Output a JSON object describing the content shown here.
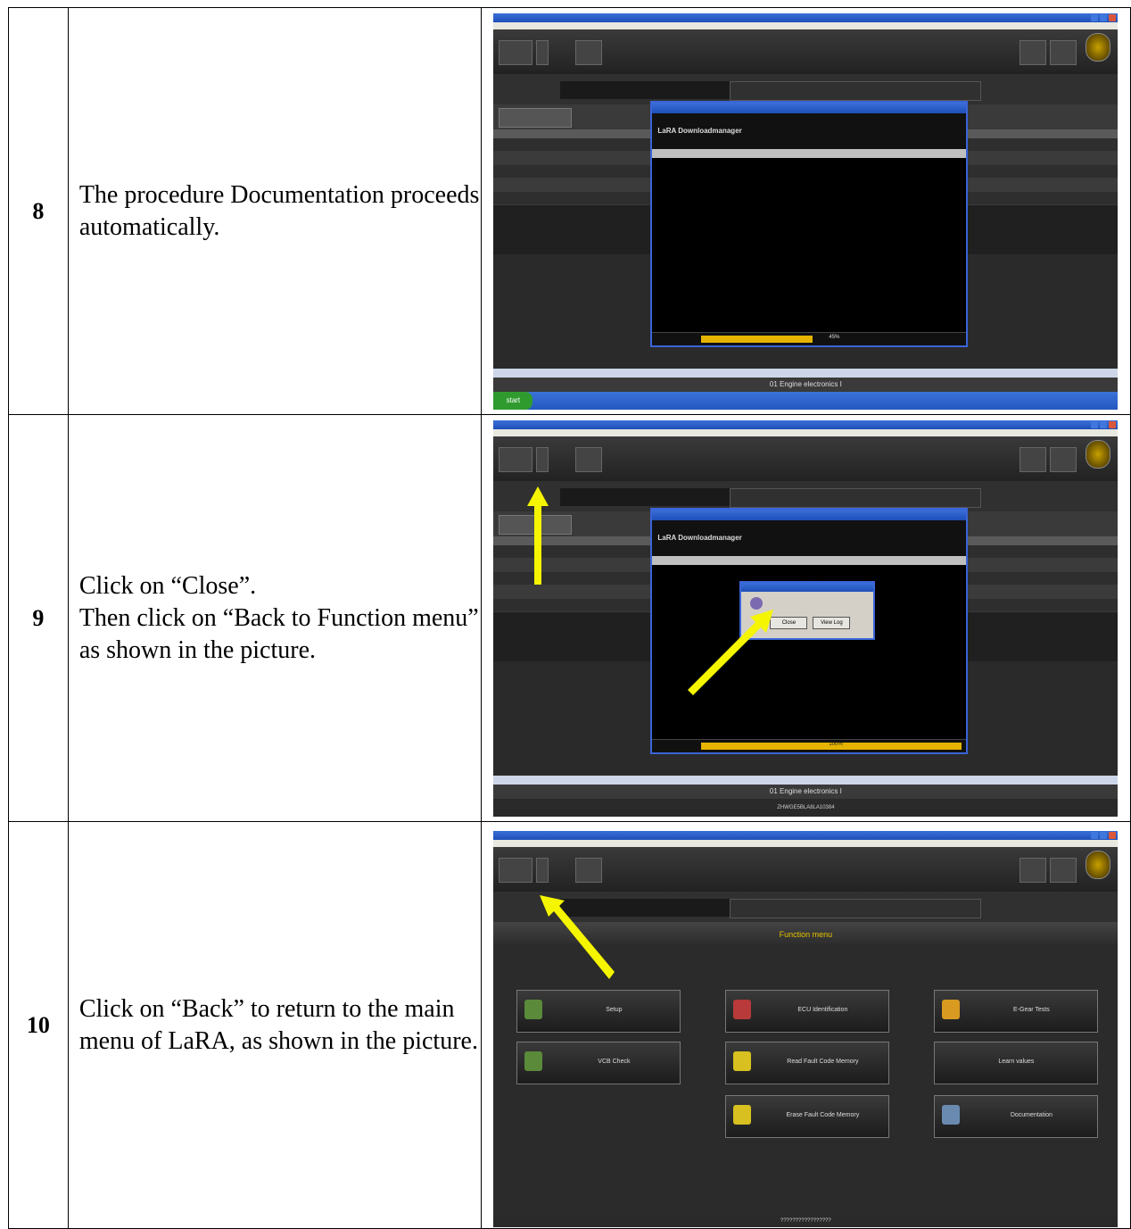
{
  "steps": [
    {
      "number": "8",
      "text": "The procedure Documentation proceeds automatically."
    },
    {
      "number": "9",
      "line1": "Click on “Close”.",
      "line2": "Then click on “Back to Function menu” as shown in the picture."
    },
    {
      "number": "10",
      "text": "Click on “Back” to return to the main menu of LaRA, as shown in the picture."
    }
  ],
  "screens": {
    "downloadmanager_title": "LaRA Downloadmanager",
    "bottom_label": "01 Engine electronics I",
    "close_button": "Close",
    "viewlog_button": "View Log",
    "progress_8": "45%",
    "progress_9": "100%",
    "statusbar_vin": "ZHWGE5BLA8LA10384",
    "function_menu_title": "Function menu",
    "function_buttons": [
      "Setup",
      "ECU Identification",
      "E-Gear Tests",
      "VCB Check",
      "Read Fault Code Memory",
      "Learn values",
      "Erase Fault Code Memory",
      "Documentation"
    ],
    "statusbar_vin_10": "?????????????????"
  },
  "colors": {
    "arrow": "#f5f500",
    "progress": "#e6b400",
    "xp_blue": "#3a64d8"
  }
}
